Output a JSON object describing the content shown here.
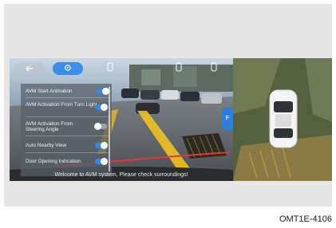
{
  "topbar": {
    "back_icon": "back-arrow-icon",
    "settings_icon": "gear-icon",
    "view_icons": [
      "car-view-icon",
      "car-view-icon",
      "car-view-icon"
    ]
  },
  "menu": {
    "items": [
      {
        "label": "AVM Start Animation",
        "state": "on"
      },
      {
        "label": "AVM Activation From Turn Light",
        "state": "on"
      },
      {
        "label": "AVM Activation From Steering Angle",
        "state": "off"
      },
      {
        "label": "Auto Nearby View",
        "state": "on"
      },
      {
        "label": "Door Opening Indication",
        "state": "on"
      }
    ]
  },
  "side_tab": {
    "label": "F"
  },
  "banner": {
    "text": "Welcome to AVM system, Please check surroundings!"
  },
  "caption": {
    "text": "OMT1E-4106"
  },
  "colors": {
    "accent": "#2f8bf0",
    "guide_yellow": "#f0c21e",
    "guide_red": "#e23b2e"
  }
}
